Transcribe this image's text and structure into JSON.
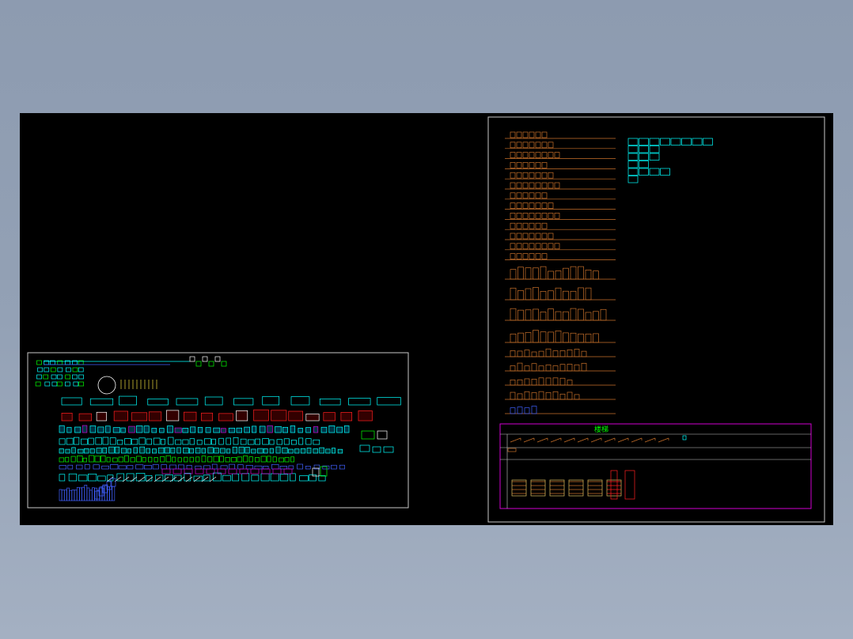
{
  "drawing": {
    "title_block_label": "楼梯",
    "background_color": "#000000",
    "viewport_color": "#8f9db2"
  },
  "colors": {
    "frame": "#c8c8c8",
    "orange": "#c8702a",
    "cyan": "#00ffff",
    "magenta": "#d000d0",
    "green": "#00ff00",
    "red": "#ff2020",
    "white": "#ffffff",
    "blue": "#4060ff"
  },
  "left_sheet": {
    "row_counts": [
      12,
      18,
      38,
      36,
      46,
      40,
      34,
      28,
      22
    ],
    "top_cluster_count": 28
  },
  "right_sheet": {
    "elevation_rows": 13,
    "door_rows": 4,
    "window_rows": 5,
    "cyan_grid": [
      8,
      3,
      3,
      2,
      4,
      1
    ],
    "stair_blocks": 12,
    "section_blocks": 6
  }
}
